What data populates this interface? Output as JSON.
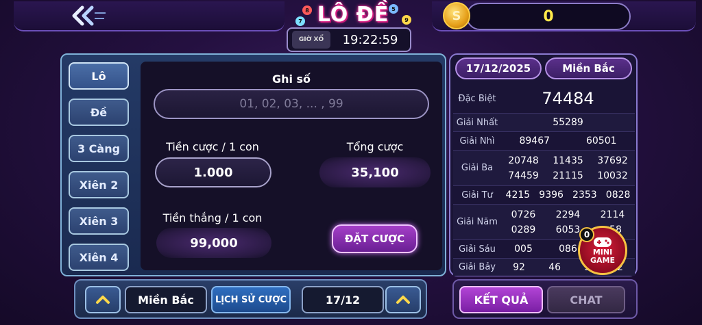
{
  "header": {
    "logo_text": "LÔ ĐỀ",
    "balls": [
      "8",
      "5",
      "7",
      "9"
    ],
    "draw_time_label": "GIỜ XỔ",
    "draw_time": "19:22:59",
    "coin_symbol": "S",
    "balance": "0"
  },
  "tabs": [
    {
      "label": "Lô",
      "active": true
    },
    {
      "label": "Đề",
      "active": false
    },
    {
      "label": "3 Càng",
      "active": false
    },
    {
      "label": "Xiên 2",
      "active": false
    },
    {
      "label": "Xiên 3",
      "active": false
    },
    {
      "label": "Xiên 4",
      "active": false
    }
  ],
  "bet_form": {
    "numbers_label": "Ghi số",
    "numbers_placeholder": "01, 02, 03, ... , 99",
    "stake_label": "Tiền cược / 1 con",
    "stake_value": "1.000",
    "total_label": "Tổng cược",
    "total_value": "35,100",
    "win_label": "Tiền thắng / 1 con",
    "win_value": "99,000",
    "place_bet_label": "ĐẶT CƯỢC"
  },
  "results": {
    "date": "17/12/2025",
    "region": "Miền Bắc",
    "rows": [
      {
        "name": "Đặc Biệt",
        "values": [
          "74484"
        ]
      },
      {
        "name": "Giải Nhất",
        "values": [
          "55289"
        ]
      },
      {
        "name": "Giải Nhì",
        "values": [
          "89467",
          "60501"
        ]
      },
      {
        "name": "Giải Ba",
        "values": [
          "20748",
          "11435",
          "37692",
          "74459",
          "21115",
          "10032"
        ]
      },
      {
        "name": "Giải Tư",
        "values": [
          "4215",
          "9396",
          "2353",
          "0828"
        ]
      },
      {
        "name": "Giải Năm",
        "values": [
          "0726",
          "2294",
          "2114",
          "0289",
          "6053",
          "..58"
        ]
      },
      {
        "name": "Giải Sáu",
        "values": [
          "005",
          "086",
          ""
        ]
      },
      {
        "name": "Giải Bảy",
        "values": [
          "92",
          "46",
          "5.",
          "2"
        ]
      }
    ]
  },
  "mini_game": {
    "badge": "0",
    "label_line1": "MINI",
    "label_line2": "GAME"
  },
  "bottom": {
    "region": "Miền Bắc",
    "history_label": "LỊCH SỬ CƯỢC",
    "date": "17/12",
    "result_label": "KẾT QUẢ",
    "chat_label": "CHAT",
    "up_arrow": "⌃"
  }
}
